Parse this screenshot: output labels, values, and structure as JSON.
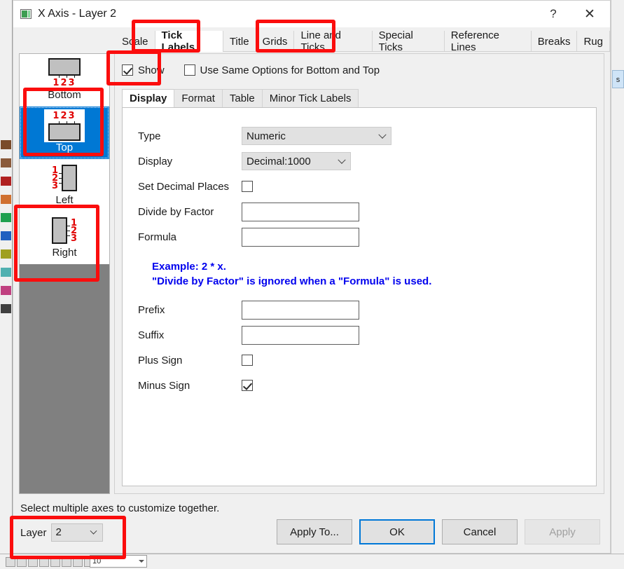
{
  "window": {
    "title": "X Axis - Layer 2",
    "icon": "axis-dialog-icon",
    "help_label": "?",
    "close_label": "✕"
  },
  "tabs": [
    {
      "label": "Scale",
      "active": false
    },
    {
      "label": "Tick Labels",
      "active": true
    },
    {
      "label": "Title",
      "active": false
    },
    {
      "label": "Grids",
      "active": false
    },
    {
      "label": "Line and Ticks",
      "active": false
    },
    {
      "label": "Special Ticks",
      "active": false
    },
    {
      "label": "Reference Lines",
      "active": false
    },
    {
      "label": "Breaks",
      "active": false
    },
    {
      "label": "Rug",
      "active": false
    }
  ],
  "axis_list": [
    {
      "label": "Bottom",
      "selected": false,
      "glyph": "axis-bottom-icon"
    },
    {
      "label": "Top",
      "selected": true,
      "glyph": "axis-top-icon"
    },
    {
      "label": "Left",
      "selected": false,
      "glyph": "axis-left-icon"
    },
    {
      "label": "Right",
      "selected": false,
      "glyph": "axis-right-icon"
    }
  ],
  "tick_digits": "1 2 3",
  "top_options": {
    "show_label": "Show",
    "show_checked": true,
    "same_options_label": "Use Same Options for Bottom and Top",
    "same_options_checked": false
  },
  "subtabs": [
    {
      "label": "Display",
      "active": true
    },
    {
      "label": "Format",
      "active": false
    },
    {
      "label": "Table",
      "active": false
    },
    {
      "label": "Minor Tick Labels",
      "active": false
    }
  ],
  "form": {
    "type_label": "Type",
    "type_value": "Numeric",
    "display_label": "Display",
    "display_value": "Decimal:1000",
    "set_decimal_places_label": "Set Decimal Places",
    "set_decimal_places_checked": false,
    "divide_by_factor_label": "Divide by Factor",
    "divide_by_factor_value": "",
    "formula_label": "Formula",
    "formula_value": "",
    "note_line1": "Example: 2 * x.",
    "note_line2": "\"Divide by Factor\" is ignored when a \"Formula\" is used.",
    "prefix_label": "Prefix",
    "prefix_value": "",
    "suffix_label": "Suffix",
    "suffix_value": "",
    "plus_sign_label": "Plus Sign",
    "plus_sign_checked": false,
    "minus_sign_label": "Minus Sign",
    "minus_sign_checked": true
  },
  "footer": {
    "hint": "Select multiple axes to customize together.",
    "layer_label": "Layer",
    "layer_value": "2",
    "buttons": [
      {
        "label": "Apply To...",
        "state": "normal"
      },
      {
        "label": "OK",
        "state": "default"
      },
      {
        "label": "Cancel",
        "state": "normal"
      },
      {
        "label": "Apply",
        "state": "disabled"
      }
    ]
  },
  "background": {
    "right_tab_label": "s",
    "bottom_combo_value": "10"
  },
  "colors": {
    "selection_blue": "#0078d4",
    "annotation_red": "#fb0d0d",
    "note_blue": "#0000ee",
    "tick_digit_red": "#e00000",
    "panel_gray": "#808080"
  }
}
